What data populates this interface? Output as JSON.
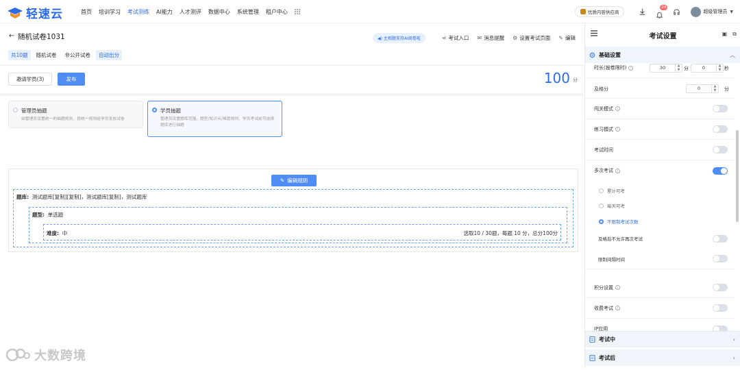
{
  "topbar": {
    "brand": "轻速云",
    "nav": [
      {
        "label": "首页",
        "active": false
      },
      {
        "label": "培训学习",
        "active": false
      },
      {
        "label": "考试测练",
        "active": true
      },
      {
        "label": "AI能力",
        "active": false
      },
      {
        "label": "人才测评",
        "active": false
      },
      {
        "label": "数据中心",
        "active": false
      },
      {
        "label": "系统管理",
        "active": false
      },
      {
        "label": "租户中心",
        "active": false
      }
    ],
    "rec_label": "优质内容供应商",
    "notification_count": "24",
    "user_name": "超级管理员"
  },
  "exam": {
    "back_icon": "arrow-left-icon",
    "title": "随机试卷1031",
    "tags": [
      "共10题",
      "随机试卷",
      "非公开试卷",
      "自动出分"
    ],
    "ai_pill": "主观题支持AI阅卷啦",
    "actions": [
      "考试入口",
      "消息提醒",
      "设置考试页面",
      "编辑"
    ],
    "invite_label": "邀请学员(3)",
    "publish_label": "发布",
    "score": "100",
    "score_unit": "分"
  },
  "modes": [
    {
      "title": "管理员抽题",
      "desc": "由管理员设置统一的抽题规则，按统一规则给学员发放试卷",
      "selected": false
    },
    {
      "title": "学员抽题",
      "desc": "管理员设置题库范围，题型/知识点/难度规则，学员考试前可选择题库进行抽题",
      "selected": true
    }
  ],
  "rules": {
    "edit_label": "编辑规则",
    "bank_label": "题库:",
    "bank_value": "测试题库[复制][复制]，测试题库[复制]，测试题库",
    "type_label": "题型:",
    "type_value": "单选题",
    "difficulty_label": "难度:",
    "difficulty_value": "中",
    "summary": "选取10 / 30题，每题 10 分，总分100分"
  },
  "settings": {
    "title": "考试设置",
    "sections": {
      "basic": "基础设置",
      "during": "考试中",
      "after": "考试后"
    },
    "duration_label": "时长(按卷限时)",
    "duration_min": "30",
    "duration_min_unit": "分",
    "duration_sec": "0",
    "duration_sec_unit": "秒",
    "pass_label": "及格分",
    "pass_value": "0",
    "pass_unit": "分",
    "toggles": [
      {
        "label": "闯关模式",
        "on": false
      },
      {
        "label": "练习模式",
        "on": false
      },
      {
        "label": "考试时间",
        "on": false
      },
      {
        "label": "多次考试",
        "on": true
      }
    ],
    "retake_options": [
      {
        "label": "累计可考",
        "selected": false
      },
      {
        "label": "每天可考",
        "selected": false
      },
      {
        "label": "不限制考试次数",
        "selected": true
      }
    ],
    "sub_toggles": [
      {
        "label": "及格后不允许再次考试",
        "on": false
      },
      {
        "label": "限制间隔时间",
        "on": false
      }
    ],
    "more_toggles": [
      {
        "label": "积分设置",
        "on": false
      },
      {
        "label": "收费考试",
        "on": false
      },
      {
        "label": "IP应用",
        "on": false
      }
    ]
  },
  "watermark": "大数跨境",
  "colors": {
    "accent": "#2e6be6",
    "button": "#4f8df5",
    "badge": "#f56c6c"
  }
}
